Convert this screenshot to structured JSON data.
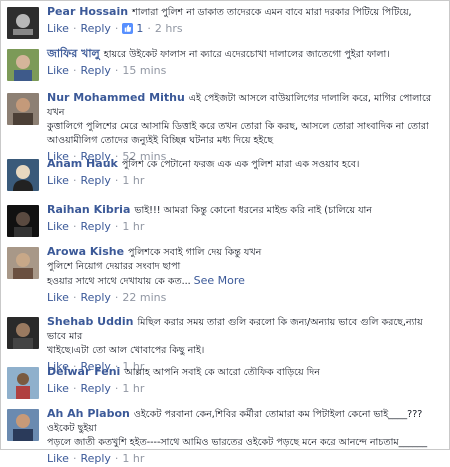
{
  "actions": {
    "like": "Like",
    "reply": "Reply",
    "see_more": "See More"
  },
  "comments": [
    {
      "name": "Pear Hossain",
      "text": "শালারা পুলিশ না ডাকাত তাদেরকে এমন বাবে মারা দরকার পিটিয়ে পিটিয়ে,",
      "likes": "1",
      "time": "2 hrs"
    },
    {
      "name": "জাফির খালু",
      "text": "হায়রে উইকেট ফালাস না ক্যারে এদেরচোখা দালালের জাতেগো পুইরা ফালা।",
      "time": "15 mins"
    },
    {
      "name": "Nur Mohammed Mithu",
      "text_lines": [
        "এই পেইজটা আসলে বাউয়ালিগের দালালি করে, মাগির পোলারে যখন",
        "কুত্তালিগে পুলিশের মেরে আসামি ডিত্তাই করে তখন তোরা কি করছ, আসলে তোরা সাংবাদিক না তোরা",
        "আওয়ামীলিগ তোদের জন্যুইই বিচ্ছিন্ন ঘটনার মধ্য দিয়ে হইছে"
      ],
      "time": "52 mins"
    },
    {
      "name": "Anam Hauk",
      "text": "পুলিশ কে পেটানো ফরজ এক এক পুলিশ মারা এক সওয়াব হবে।",
      "time": "1 hr"
    },
    {
      "name": "Raihan Kibria",
      "text": "ভাই!!! আমরা কিন্তু কোনো ধরনের মাইন্ড করি নাই (চালিয়ে যান",
      "time": "1 hr"
    },
    {
      "name": "Arowa Kishe",
      "text_lines": [
        "পুলিশকে সবাই গালি দেয় কিন্তু যখন",
        "পুলিশে নিয়োগ দেয়ারর সংবাদ ছাপা",
        "হওয়ার সাথে সাথে দেখাযায় কে কত..."
      ],
      "time": "22 mins"
    },
    {
      "name": "Shehab Uddin",
      "text_lines": [
        "মিছিল করার সময় তারা গুলি করলো কি জন্য/অন্যায় ভাবে গুলি করছে,ন্যায় ভাবে মার",
        "খাইছে।এটা তো আল খোবাপের কিছু নাই।"
      ],
      "time": "1 hr"
    },
    {
      "name": "Delwar Feni",
      "text": "আল্লাহ আপনি সবাই কে আরো তৌফিক বাড়িয়ে দিন",
      "time": "1 hr"
    },
    {
      "name": "Ah Ah Plabon",
      "text_lines": [
        "ওইকেট পরবানা কেন,শিবির কর্মীরা তোমারা কম পিটাইলা কেনো ভাই____???ওইকেট ছুইয়া",
        "পড়লে জাতী কতখুশি হইত----সাথে আমিও ভারতের ওইকেট পড়ছে মনে করে আনন্দে নাচতাম______"
      ],
      "time": "1 hr"
    }
  ],
  "avatar_colors": [
    "#4a4a4a",
    "#6b8a3c",
    "#7a6a5a",
    "#2f4f6f",
    "#1f1f1f",
    "#8a7a6a",
    "#3d3d3d",
    "#6f8fa8",
    "#5a7aa0"
  ]
}
